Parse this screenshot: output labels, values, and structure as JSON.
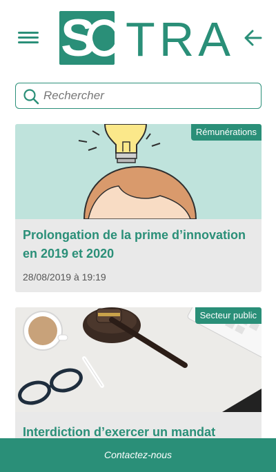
{
  "header": {
    "logo_mark": "SO",
    "logo_text": "TRA"
  },
  "search": {
    "placeholder": "Rechercher",
    "value": ""
  },
  "articles": [
    {
      "category": "Rémunérations",
      "title": "Prolongation de la prime d’innovation en 2019 et 2020",
      "date": "28/08/2019 à 19:19",
      "image_icon": "lightbulb-idea-illustration"
    },
    {
      "category": "Secteur public",
      "title": "Interdiction d’exercer un mandat public",
      "date": "",
      "image_icon": "desk-gavel-photo"
    }
  ],
  "footer": {
    "contact_label": "Contactez-nous"
  },
  "colors": {
    "brand": "#2a8f78",
    "card_bg": "#e9e9e9"
  }
}
